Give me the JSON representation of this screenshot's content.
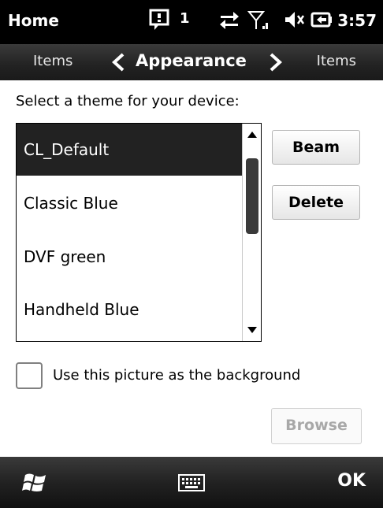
{
  "status": {
    "title": "Home",
    "notification_count": "1",
    "time": "3:57",
    "icons": [
      "notification-icon",
      "data-connection-icon",
      "signal-icon",
      "volume-muted-icon",
      "battery-charging-icon"
    ]
  },
  "tabs": {
    "left": "Items",
    "current": "Appearance",
    "right": "Items"
  },
  "main": {
    "prompt": "Select a theme for your device:",
    "themes": [
      "CL_Default",
      "Classic Blue",
      "DVF green",
      "Handheld Blue"
    ],
    "selected_index": 0,
    "buttons": {
      "beam": "Beam",
      "delete": "Delete",
      "browse": "Browse"
    },
    "background_checkbox": {
      "label": "Use this picture as the background",
      "checked": false
    }
  },
  "softkeys": {
    "right": "OK"
  },
  "colors": {
    "selected_bg": "#222222",
    "bar_bg": "#1a1a1a",
    "disabled_text": "#a8a8a8"
  }
}
